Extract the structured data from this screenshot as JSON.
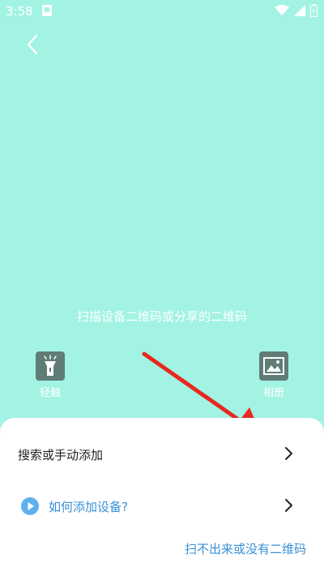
{
  "status_bar": {
    "time": "3:58"
  },
  "scan": {
    "hint": "扫描设备二维码或分享的二维码"
  },
  "tools": {
    "flash_label": "轻触",
    "album_label": "相册"
  },
  "sheet": {
    "manual_add_label": "搜索或手动添加",
    "how_to_add_label": "如何添加设备?",
    "no_code_link": "扫不出来或没有二维码"
  },
  "colors": {
    "background": "#a2f3e3",
    "tool_icon_bg": "#5f7c76",
    "link_blue": "#3a8fd6",
    "annotation_red": "#e8281f"
  },
  "icons": [
    "back-arrow-icon",
    "flashlight-icon",
    "album-image-icon",
    "chevron-right-icon",
    "play-icon",
    "wifi-icon",
    "signal-icon",
    "battery-icon"
  ]
}
